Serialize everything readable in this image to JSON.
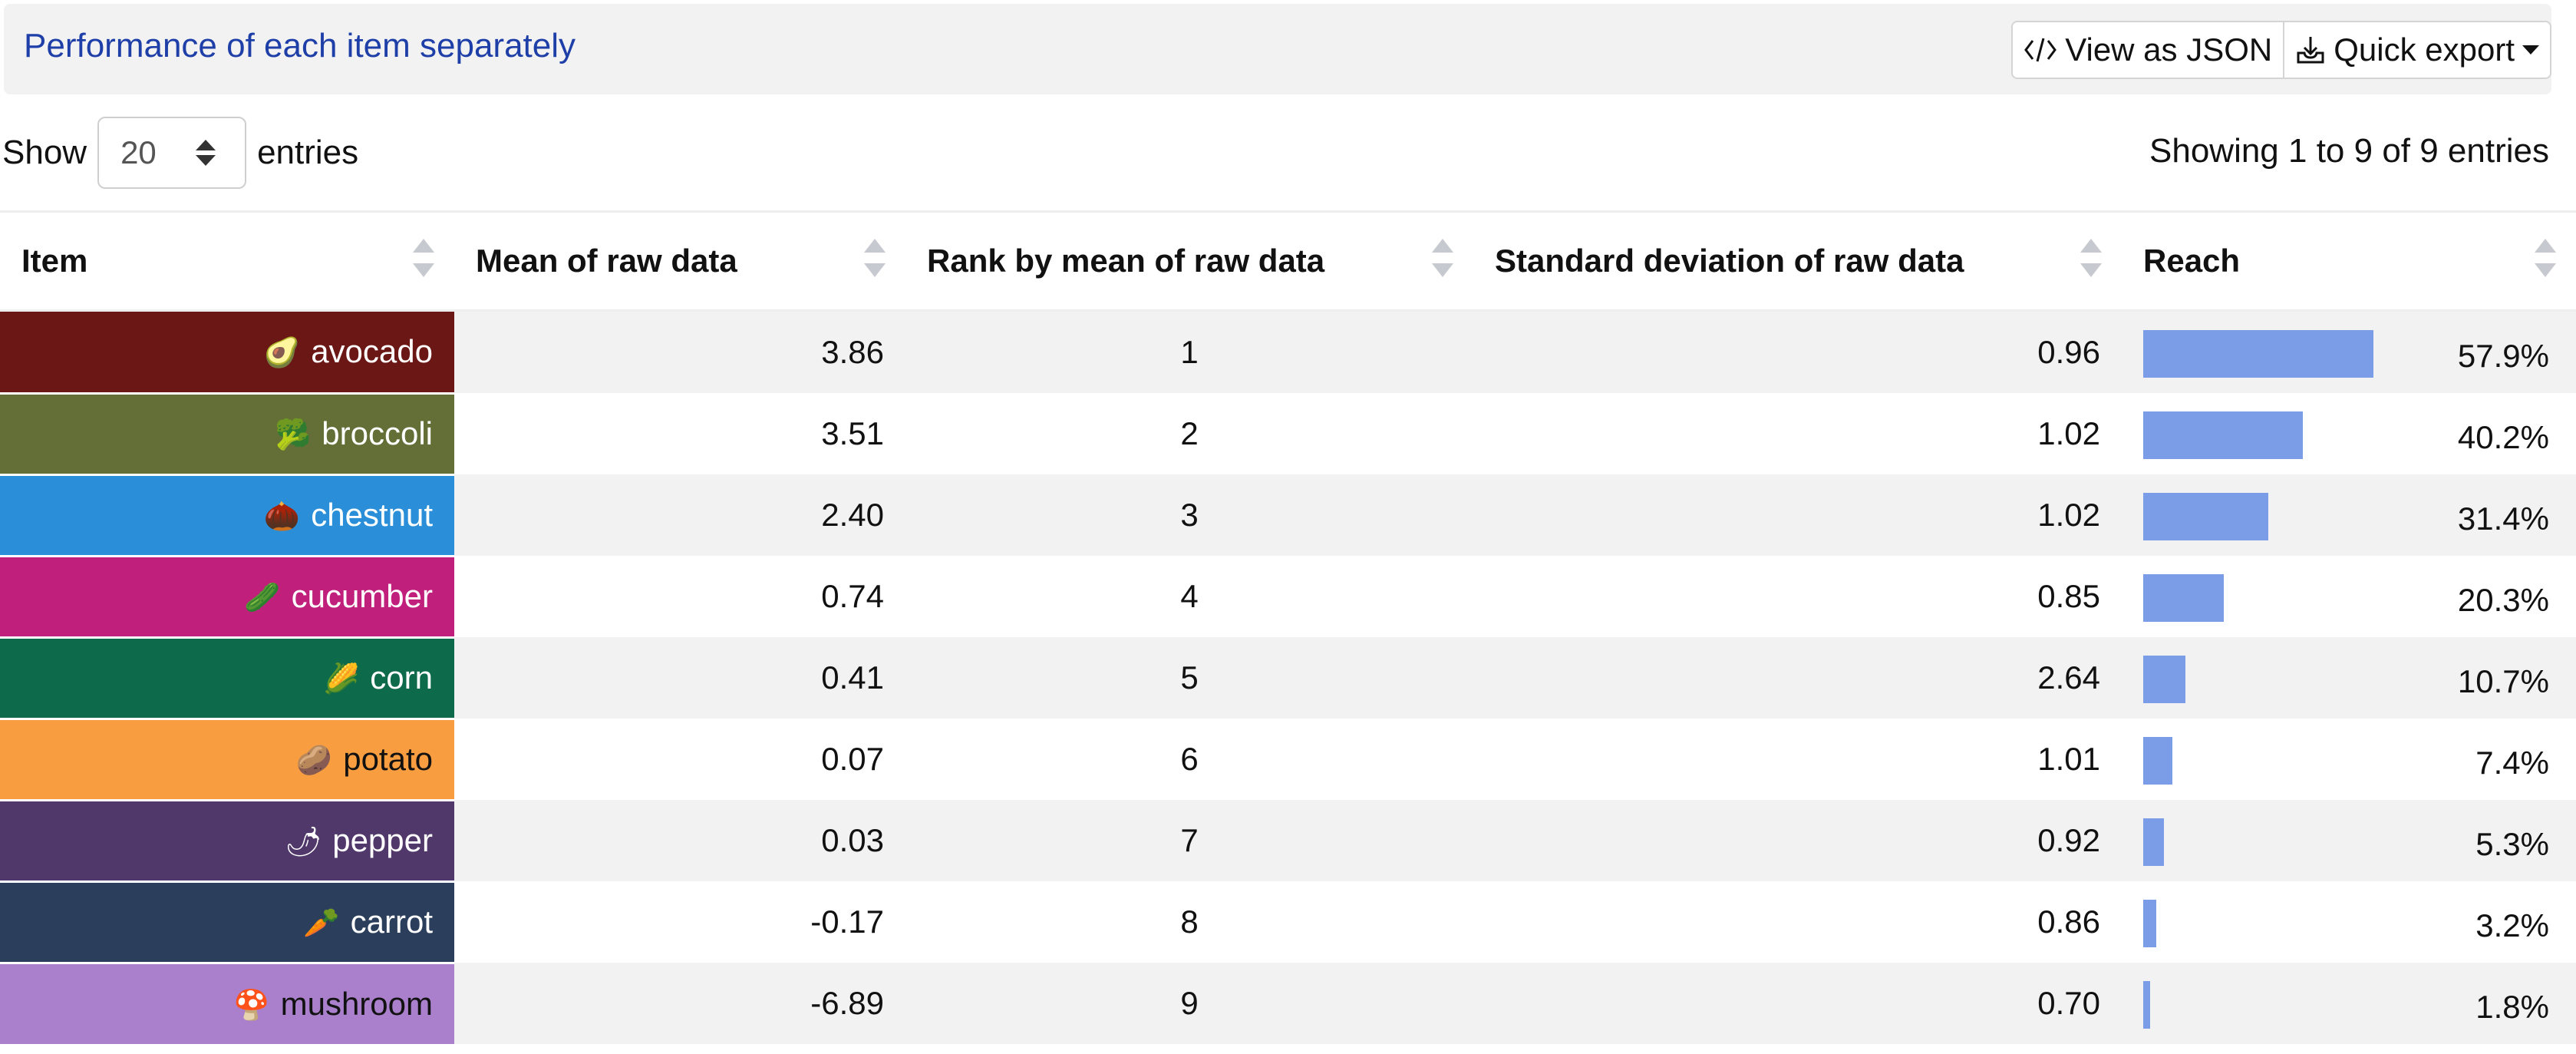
{
  "header": {
    "title": "Performance of each item separately",
    "view_json_label": "View as JSON",
    "view_json_icon": "code-icon",
    "quick_export_label": "Quick export",
    "quick_export_icon": "download-tray-icon"
  },
  "length_menu": {
    "show_label": "Show",
    "value": "20",
    "entries_label": "entries"
  },
  "info": "Showing 1 to 9 of 9 entries",
  "columns": [
    "Item",
    "Mean of raw data",
    "Rank by mean of raw data",
    "Standard deviation of raw data",
    "Reach"
  ],
  "reach_bar_color": "#7b9ce6",
  "rows": [
    {
      "item": "avocado",
      "emoji": "🥑",
      "color": "#6b1716",
      "text_color": "#ffffff",
      "mean": "3.86",
      "rank": "1",
      "sd": "0.96",
      "reach": 57.9,
      "reach_label": "57.9%"
    },
    {
      "item": "broccoli",
      "emoji": "🥦",
      "color": "#636f37",
      "text_color": "#ffffff",
      "mean": "3.51",
      "rank": "2",
      "sd": "1.02",
      "reach": 40.2,
      "reach_label": "40.2%"
    },
    {
      "item": "chestnut",
      "emoji": "🌰",
      "color": "#2a8fd8",
      "text_color": "#ffffff",
      "mean": "2.40",
      "rank": "3",
      "sd": "1.02",
      "reach": 31.4,
      "reach_label": "31.4%"
    },
    {
      "item": "cucumber",
      "emoji": "🥒",
      "color": "#c01f7c",
      "text_color": "#ffffff",
      "mean": "0.74",
      "rank": "4",
      "sd": "0.85",
      "reach": 20.3,
      "reach_label": "20.3%"
    },
    {
      "item": "corn",
      "emoji": "🌽",
      "color": "#0d6b4c",
      "text_color": "#ffffff",
      "mean": "0.41",
      "rank": "5",
      "sd": "2.64",
      "reach": 10.7,
      "reach_label": "10.7%"
    },
    {
      "item": "potato",
      "emoji": "🥔",
      "color": "#f89e41",
      "text_color": "#111111",
      "mean": "0.07",
      "rank": "6",
      "sd": "1.01",
      "reach": 7.4,
      "reach_label": "7.4%"
    },
    {
      "item": "pepper",
      "emoji": "🌶",
      "color": "#51386b",
      "text_color": "#ffffff",
      "mean": "0.03",
      "rank": "7",
      "sd": "0.92",
      "reach": 5.3,
      "reach_label": "5.3%"
    },
    {
      "item": "carrot",
      "emoji": "🥕",
      "color": "#2b3f5c",
      "text_color": "#ffffff",
      "mean": "-0.17",
      "rank": "8",
      "sd": "0.86",
      "reach": 3.2,
      "reach_label": "3.2%"
    },
    {
      "item": "mushroom",
      "emoji": "🍄",
      "color": "#aa80cc",
      "text_color": "#111111",
      "mean": "-6.89",
      "rank": "9",
      "sd": "0.70",
      "reach": 1.8,
      "reach_label": "1.8%"
    }
  ]
}
